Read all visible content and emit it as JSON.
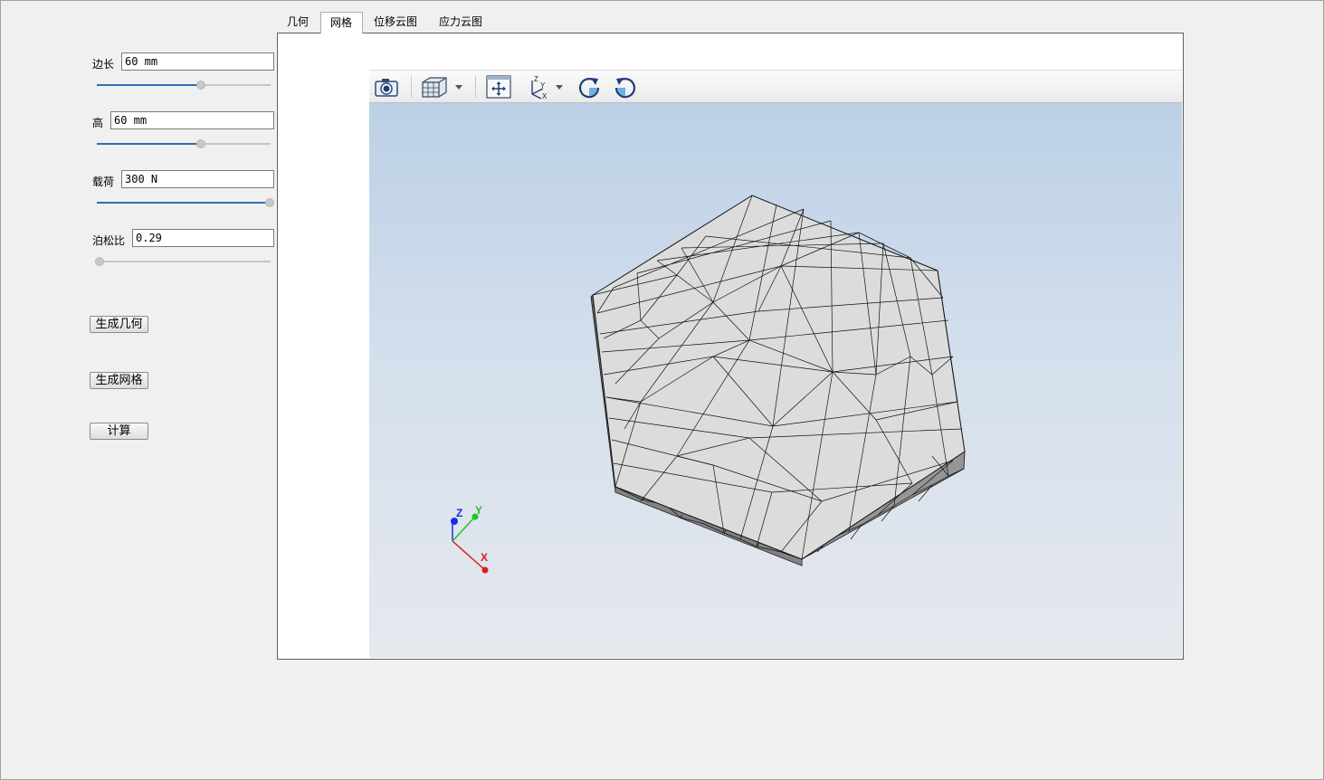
{
  "params": [
    {
      "label": "边长",
      "value": "60 mm",
      "slider": 0.6
    },
    {
      "label": "高",
      "value": "60 mm",
      "slider": 0.6
    },
    {
      "label": "载荷",
      "value": "300 N",
      "slider": 1.0
    },
    {
      "label": "泊松比",
      "value": "0.29",
      "slider": 0.0
    }
  ],
  "buttons": {
    "generate_geometry": "生成几何",
    "generate_mesh": "生成网格",
    "compute": "计算"
  },
  "tabs": [
    "几何",
    "网格",
    "位移云图",
    "应力云图"
  ],
  "active_tab": "网格",
  "toolbar": {
    "icons": [
      "camera-icon",
      "view-cube-icon",
      "fit-all-icon",
      "axes-orientation-icon",
      "rotate-cw-icon",
      "rotate-ccw-icon"
    ],
    "axes_icon_labels": {
      "z": "Z",
      "y": "Y",
      "x": "X"
    }
  },
  "triad": {
    "x": "X",
    "y": "Y",
    "z": "Z"
  },
  "colors": {
    "slider_fill": "#2f6fb2",
    "axis_x": "#e01b1b",
    "axis_y": "#22c322",
    "axis_z": "#1a2ee0",
    "mesh_face": "#dcdcdc",
    "mesh_side": "#8e8e8e"
  }
}
